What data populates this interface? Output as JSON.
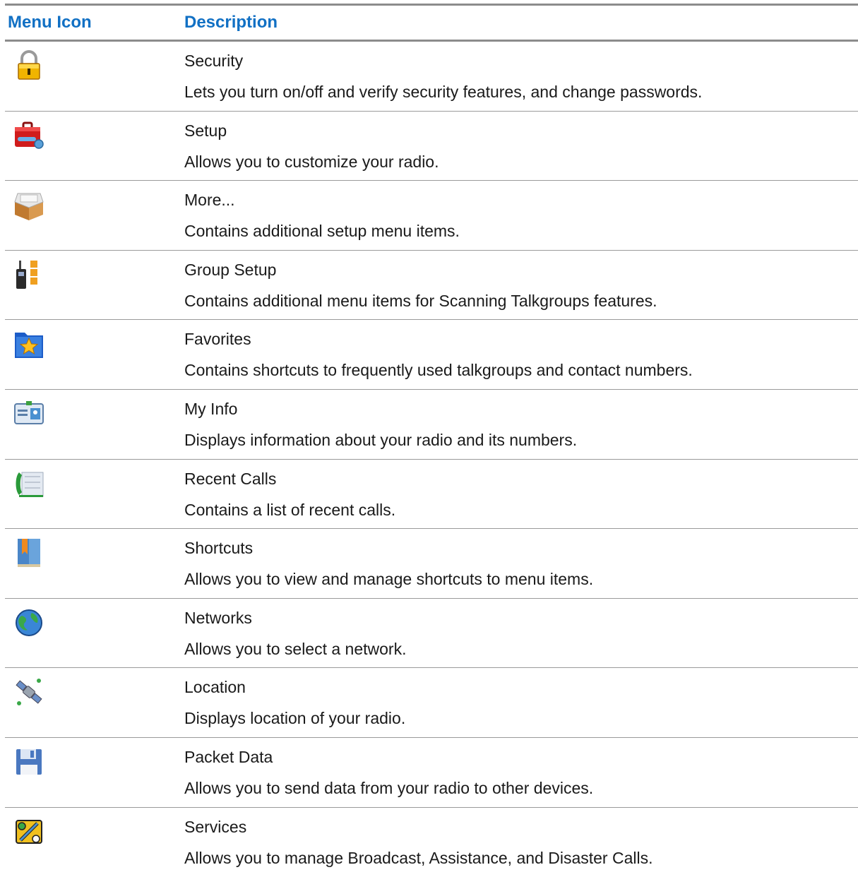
{
  "header": {
    "icon_col": "Menu Icon",
    "desc_col": "Description"
  },
  "items": [
    {
      "icon": "lock-icon",
      "title": "Security",
      "text": "Lets you turn on/off and verify security features, and change passwords."
    },
    {
      "icon": "toolbox-icon",
      "title": "Setup",
      "text": "Allows you to customize your radio."
    },
    {
      "icon": "box-icon",
      "title": "More...",
      "text": "Contains additional setup menu items."
    },
    {
      "icon": "radio-group-icon",
      "title": "Group Setup",
      "text": "Contains additional menu items for Scanning Talkgroups features."
    },
    {
      "icon": "star-folder-icon",
      "title": "Favorites",
      "text": "Contains shortcuts to frequently used talkgroups and contact numbers."
    },
    {
      "icon": "id-card-icon",
      "title": "My Info",
      "text": "Displays information about your radio and its numbers."
    },
    {
      "icon": "phone-list-icon",
      "title": "Recent Calls",
      "text": "Contains a list of recent calls."
    },
    {
      "icon": "bookmark-book-icon",
      "title": "Shortcuts",
      "text": "Allows you to view and manage shortcuts to menu items."
    },
    {
      "icon": "globe-icon",
      "title": "Networks",
      "text": "Allows you to select a network."
    },
    {
      "icon": "satellite-icon",
      "title": "Location",
      "text": "Displays location of your radio."
    },
    {
      "icon": "floppy-disk-icon",
      "title": "Packet Data",
      "text": "Allows you to send data from your radio to other devices."
    },
    {
      "icon": "services-icon",
      "title": "Services",
      "text": "Allows you to manage Broadcast, Assistance, and Disaster Calls."
    }
  ]
}
